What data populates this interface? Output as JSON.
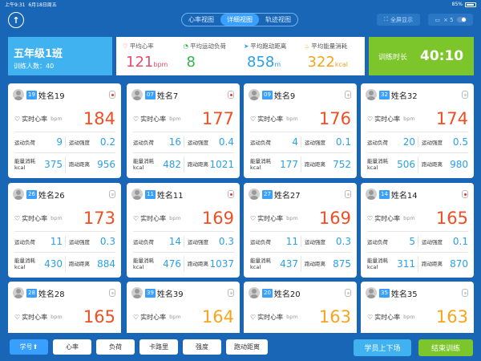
{
  "status_bar": {
    "time": "上午9:31",
    "date": "6月18日周五",
    "battery": "85%"
  },
  "nav": {
    "tabs": [
      "心率视图",
      "详细视图",
      "轨迹视图"
    ],
    "active_tab": "详细视图",
    "fullscreen_label": "全屏显示",
    "screen_count": "× 5"
  },
  "class_info": {
    "name": "五年级1班",
    "count_label": "训练人数：",
    "count": "40"
  },
  "stats": {
    "avg_hr": {
      "label": "平均心率",
      "value": "121",
      "unit": "bpm"
    },
    "avg_load": {
      "label": "平均运动负荷",
      "value": "8",
      "unit": ""
    },
    "avg_dist": {
      "label": "平均跑动距离",
      "value": "858",
      "unit": "m"
    },
    "avg_energy": {
      "label": "平均能量消耗",
      "value": "322",
      "unit": "kcal"
    }
  },
  "training_time": {
    "label": "训练时长",
    "value": "40:10"
  },
  "card_labels": {
    "hr": "实时心率",
    "bpm": "bpm",
    "load": "运动负荷",
    "intensity": "运动强度",
    "energy": "能量消耗",
    "kcal": "kcal",
    "distance": "跑动距离"
  },
  "cards": [
    {
      "num": "19",
      "name": "姓名19",
      "device": "on",
      "hr": "184",
      "hr_color": "red",
      "load": "9",
      "intensity": "0.2",
      "energy": "375",
      "distance": "956"
    },
    {
      "num": "07",
      "name": "姓名7",
      "device": "on",
      "hr": "177",
      "hr_color": "red",
      "load": "16",
      "intensity": "0.4",
      "energy": "482",
      "distance": "1021"
    },
    {
      "num": "09",
      "name": "姓名9",
      "device": "off",
      "hr": "176",
      "hr_color": "red",
      "load": "4",
      "intensity": "0.1",
      "energy": "177",
      "distance": "752"
    },
    {
      "num": "32",
      "name": "姓名32",
      "device": "off",
      "hr": "174",
      "hr_color": "red",
      "load": "20",
      "intensity": "0.5",
      "energy": "506",
      "distance": "980"
    },
    {
      "num": "26",
      "name": "姓名26",
      "device": "off",
      "hr": "173",
      "hr_color": "red",
      "load": "11",
      "intensity": "0.3",
      "energy": "430",
      "distance": "884"
    },
    {
      "num": "11",
      "name": "姓名11",
      "device": "on",
      "hr": "169",
      "hr_color": "red",
      "load": "14",
      "intensity": "0.3",
      "energy": "476",
      "distance": "1037"
    },
    {
      "num": "27",
      "name": "姓名27",
      "device": "off",
      "hr": "169",
      "hr_color": "red",
      "load": "11",
      "intensity": "0.3",
      "energy": "437",
      "distance": "875"
    },
    {
      "num": "14",
      "name": "姓名14",
      "device": "on",
      "hr": "165",
      "hr_color": "red",
      "load": "5",
      "intensity": "0.1",
      "energy": "311",
      "distance": "870"
    },
    {
      "num": "28",
      "name": "姓名28",
      "device": "off",
      "hr": "165",
      "hr_color": "red"
    },
    {
      "num": "39",
      "name": "姓名39",
      "device": "off",
      "hr": "164",
      "hr_color": "orange"
    },
    {
      "num": "20",
      "name": "姓名20",
      "device": "off",
      "hr": "163",
      "hr_color": "orange"
    },
    {
      "num": "35",
      "name": "姓名35",
      "device": "off",
      "hr": "163",
      "hr_color": "orange"
    }
  ],
  "sort_buttons": [
    "学号⬆",
    "心率",
    "负荷",
    "卡路里",
    "强度",
    "跑动距离"
  ],
  "active_sort": "学号⬆",
  "actions": {
    "swap": "学员上下场",
    "end": "结束训练"
  },
  "colors": {
    "bg": "#1a66b6",
    "accent": "#3aa0ff",
    "end_button": "#7cc62b",
    "swap_button": "#3fb2ef"
  }
}
